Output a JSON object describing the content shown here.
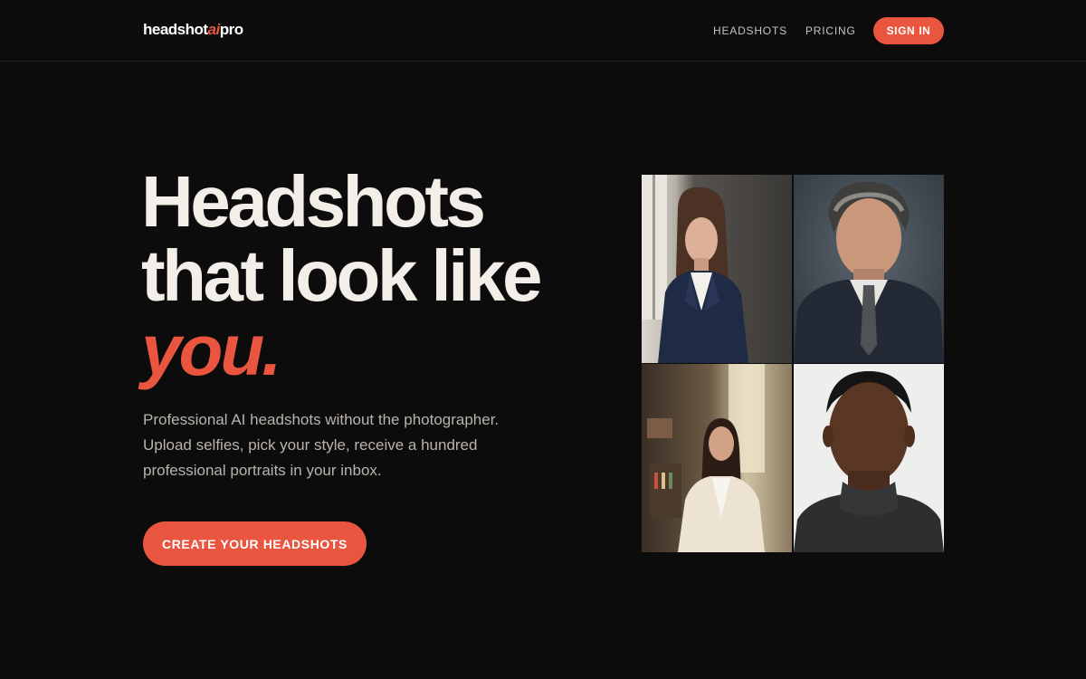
{
  "header": {
    "logo": {
      "part1": "headshot",
      "part2": "ai",
      "part3": "pro"
    },
    "nav": {
      "headshots": "HEADSHOTS",
      "pricing": "PRICING"
    },
    "signin_label": "SIGN IN"
  },
  "hero": {
    "title_line1": "Headshots",
    "title_line2": "that look like",
    "title_accent": "you.",
    "subtitle_line1": "Professional AI headshots without the photographer.",
    "subtitle_line2": "Upload selfies, pick your style, receive a hundred",
    "subtitle_line3": "professional portraits in your inbox.",
    "cta_label": "CREATE YOUR HEADSHOTS"
  },
  "colors": {
    "background": "#0d0c0c",
    "accent": "#e9553f",
    "text": "#f3efe8",
    "muted": "#b9b3ab"
  }
}
